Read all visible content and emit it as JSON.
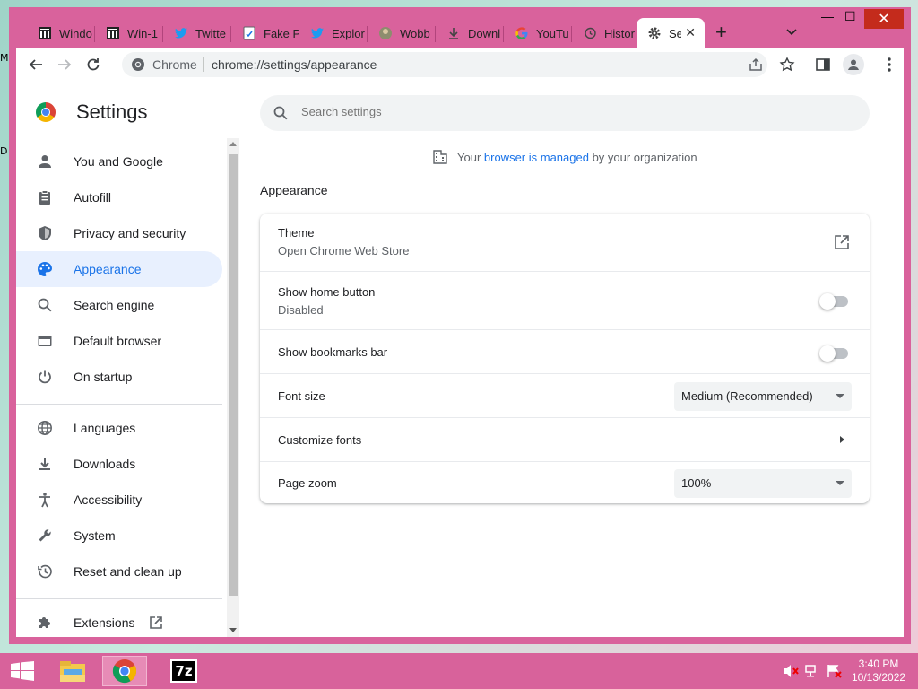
{
  "desktop": {
    "edge_labels": [
      "M",
      "D"
    ]
  },
  "tabs": [
    {
      "label": "Windo",
      "icon": "museum-icon"
    },
    {
      "label": "Win-1",
      "icon": "museum-icon"
    },
    {
      "label": "Twitte",
      "icon": "twitter-icon"
    },
    {
      "label": "Fake P",
      "icon": "page-icon"
    },
    {
      "label": "Explor",
      "icon": "twitter-icon"
    },
    {
      "label": "Wobb",
      "icon": "avatar-icon"
    },
    {
      "label": "Downl",
      "icon": "download-icon"
    },
    {
      "label": "YouTu",
      "icon": "google-icon"
    },
    {
      "label": "Histor",
      "icon": "history-icon"
    },
    {
      "label": "Se",
      "icon": "gear-icon",
      "active": true
    }
  ],
  "window_controls": {
    "minimize": "—",
    "maximize": "☐",
    "close": "✕"
  },
  "omnibox": {
    "site_label": "Chrome",
    "url": "chrome://settings/appearance"
  },
  "settings": {
    "title": "Settings",
    "search_placeholder": "Search settings",
    "managed": {
      "prefix": "Your ",
      "link": "browser is managed",
      "suffix": " by your organization"
    },
    "nav": [
      {
        "label": "You and Google",
        "icon": "person-icon"
      },
      {
        "label": "Autofill",
        "icon": "clipboard-icon"
      },
      {
        "label": "Privacy and security",
        "icon": "shield-icon"
      },
      {
        "label": "Appearance",
        "icon": "palette-icon",
        "active": true
      },
      {
        "label": "Search engine",
        "icon": "search-icon"
      },
      {
        "label": "Default browser",
        "icon": "browser-icon"
      },
      {
        "label": "On startup",
        "icon": "power-icon"
      },
      {
        "label": "Languages",
        "icon": "globe-icon"
      },
      {
        "label": "Downloads",
        "icon": "download-icon"
      },
      {
        "label": "Accessibility",
        "icon": "accessibility-icon"
      },
      {
        "label": "System",
        "icon": "wrench-icon"
      },
      {
        "label": "Reset and clean up",
        "icon": "history-icon"
      },
      {
        "label": "Extensions",
        "icon": "puzzle-icon"
      }
    ],
    "section_title": "Appearance",
    "rows": {
      "theme": {
        "title": "Theme",
        "subtitle": "Open Chrome Web Store"
      },
      "home_button": {
        "title": "Show home button",
        "subtitle": "Disabled",
        "enabled": false
      },
      "bookmarks_bar": {
        "title": "Show bookmarks bar",
        "enabled": false
      },
      "font_size": {
        "title": "Font size",
        "value": "Medium (Recommended)"
      },
      "customize_fonts": {
        "title": "Customize fonts"
      },
      "page_zoom": {
        "title": "Page zoom",
        "value": "100%"
      }
    }
  },
  "taskbar": {
    "apps": [
      {
        "name": "file-explorer-icon"
      },
      {
        "name": "chrome-icon",
        "active": true
      },
      {
        "name": "7zip-icon",
        "label": "7z"
      }
    ],
    "clock": {
      "time": "3:40 PM",
      "date": "10/13/2022"
    }
  },
  "colors": {
    "accent": "#1a73e8",
    "window_frame": "#d9629c",
    "taskbar": "#d8629b"
  }
}
